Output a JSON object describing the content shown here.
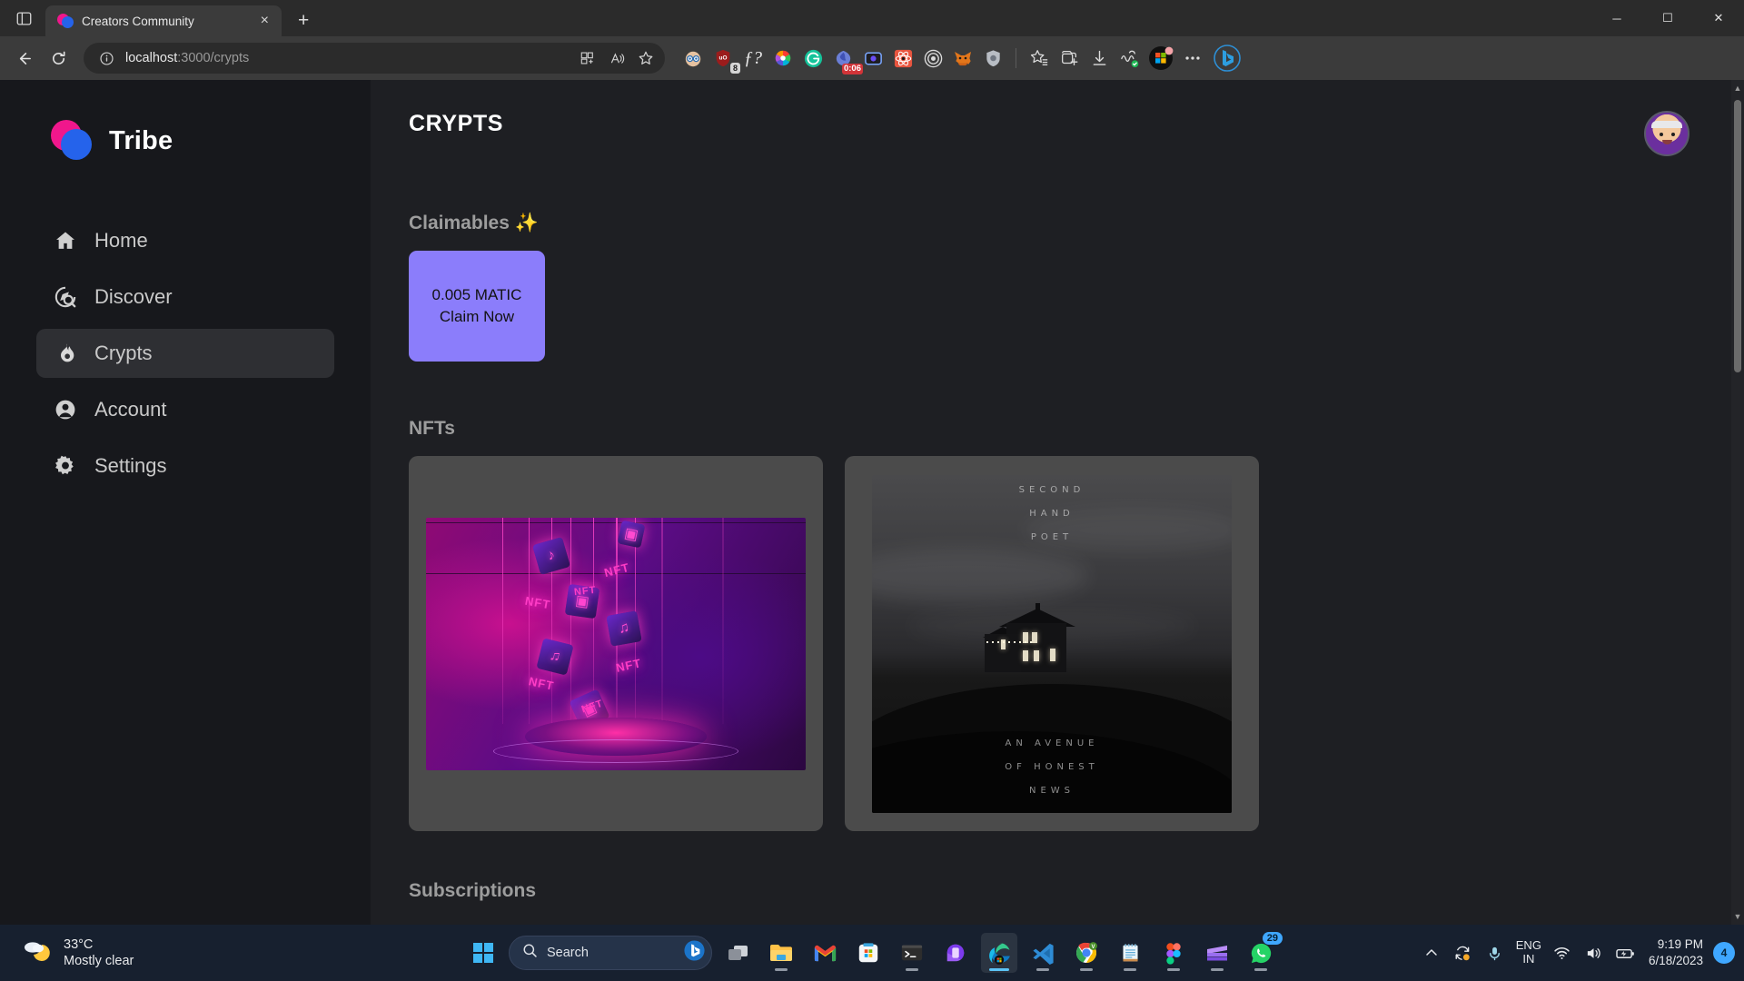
{
  "browser": {
    "tab": {
      "title": "Creators Community",
      "favicon": "tribe-logo-icon",
      "close": "×"
    },
    "new_tab_label": "+",
    "window_controls": {
      "minimize": "─",
      "maximize": "☐",
      "close": "✕"
    },
    "nav": {
      "back": "←",
      "reload": "↻"
    },
    "omnibox": {
      "info_icon": "info-circle-icon",
      "url_host": "localhost",
      "url_path": ":3000/crypts",
      "split_screen_icon": "split-screen-icon",
      "read_aloud_icon": "read-aloud-icon",
      "favorite_icon": "star-icon"
    },
    "extensions": [
      {
        "name": "ublock-privacy-icon",
        "badge": ""
      },
      {
        "name": "ublock-origin-icon",
        "badge": "8"
      },
      {
        "name": "fonts-ninja-icon",
        "badge": ""
      },
      {
        "name": "color-picker-icon",
        "badge": ""
      },
      {
        "name": "grammarly-icon",
        "badge": ""
      },
      {
        "name": "screen-recorder-icon",
        "badge": "0:06"
      },
      {
        "name": "loom-icon",
        "badge": ""
      },
      {
        "name": "react-devtools-icon",
        "badge": ""
      },
      {
        "name": "target-icon",
        "badge": ""
      },
      {
        "name": "metamask-icon",
        "badge": ""
      },
      {
        "name": "shield-privacy-icon",
        "badge": ""
      }
    ],
    "toolbar_right": [
      {
        "name": "collections-favorites-icon"
      },
      {
        "name": "collections-icon"
      },
      {
        "name": "downloads-icon"
      },
      {
        "name": "browser-essentials-icon"
      },
      {
        "name": "microsoft-rewards-icon"
      },
      {
        "name": "settings-more-icon"
      },
      {
        "name": "copilot-bing-icon"
      }
    ]
  },
  "app": {
    "sidebar": {
      "brand": "Tribe",
      "items": [
        {
          "label": "Home",
          "icon": "home-icon",
          "active": false
        },
        {
          "label": "Discover",
          "icon": "discover-icon",
          "active": false
        },
        {
          "label": "Crypts",
          "icon": "flame-icon",
          "active": true
        },
        {
          "label": "Account",
          "icon": "account-circle-icon",
          "active": false
        },
        {
          "label": "Settings",
          "icon": "gear-icon",
          "active": false
        }
      ]
    },
    "header": {
      "title": "CRYPTS",
      "avatar": "user-avatar"
    },
    "sections": {
      "claimables": {
        "label": "Claimables ✨",
        "card": {
          "amount": "0.005 MATIC",
          "action": "Claim Now",
          "color": "#8b7dfb"
        }
      },
      "nfts": {
        "label": "NFTs",
        "items": [
          {
            "name": "neon-nft-cubes-artwork",
            "alt": "Neon purple 3D cubes with NFT and music note icons"
          },
          {
            "name": "second-hand-poet-album-art",
            "alt": "Black and white house on a hill at dusk",
            "top_text_1": "SECOND",
            "top_text_2": "HAND",
            "top_text_3": "POET",
            "bottom_text_1": "AN AVENUE",
            "bottom_text_2": "OF HONEST",
            "bottom_text_3": "NEWS"
          }
        ]
      },
      "subscriptions": {
        "label": "Subscriptions"
      }
    }
  },
  "taskbar": {
    "weather": {
      "temperature": "33°C",
      "condition": "Mostly clear",
      "icon": "moon-cloud-icon"
    },
    "start": "windows-start-icon",
    "search": {
      "placeholder": "Search",
      "icon": "search-icon",
      "bing_icon": "bing-chat-icon"
    },
    "apps": [
      {
        "name": "task-view-icon",
        "badge": "",
        "active": false,
        "running": false
      },
      {
        "name": "file-explorer-icon",
        "badge": "",
        "active": false,
        "running": true
      },
      {
        "name": "gmail-icon",
        "badge": "",
        "active": false,
        "running": false
      },
      {
        "name": "microsoft-store-icon",
        "badge": "",
        "active": false,
        "running": false
      },
      {
        "name": "terminal-icon",
        "badge": "",
        "active": false,
        "running": true
      },
      {
        "name": "phone-link-icon",
        "badge": "",
        "active": false,
        "running": false
      },
      {
        "name": "microsoft-edge-icon",
        "badge": "",
        "active": true,
        "running": true
      },
      {
        "name": "vs-code-icon",
        "badge": "",
        "active": false,
        "running": true
      },
      {
        "name": "google-chrome-icon",
        "badge": "",
        "active": false,
        "running": true
      },
      {
        "name": "notepad-icon",
        "badge": "",
        "active": false,
        "running": true
      },
      {
        "name": "figma-icon",
        "badge": "",
        "active": false,
        "running": true
      },
      {
        "name": "video-editor-icon",
        "badge": "",
        "active": false,
        "running": true
      },
      {
        "name": "whatsapp-icon",
        "badge": "29",
        "active": false,
        "running": true
      }
    ],
    "tray": {
      "show_hidden": "chevron-up-icon",
      "onedrive": "onedrive-sync-icon",
      "mic": "microphone-icon",
      "language_1": "ENG",
      "language_2": "IN",
      "wifi": "wifi-icon",
      "volume": "speaker-icon",
      "battery": "battery-charging-icon",
      "time": "9:19 PM",
      "date": "6/18/2023",
      "notifications": "4"
    }
  }
}
